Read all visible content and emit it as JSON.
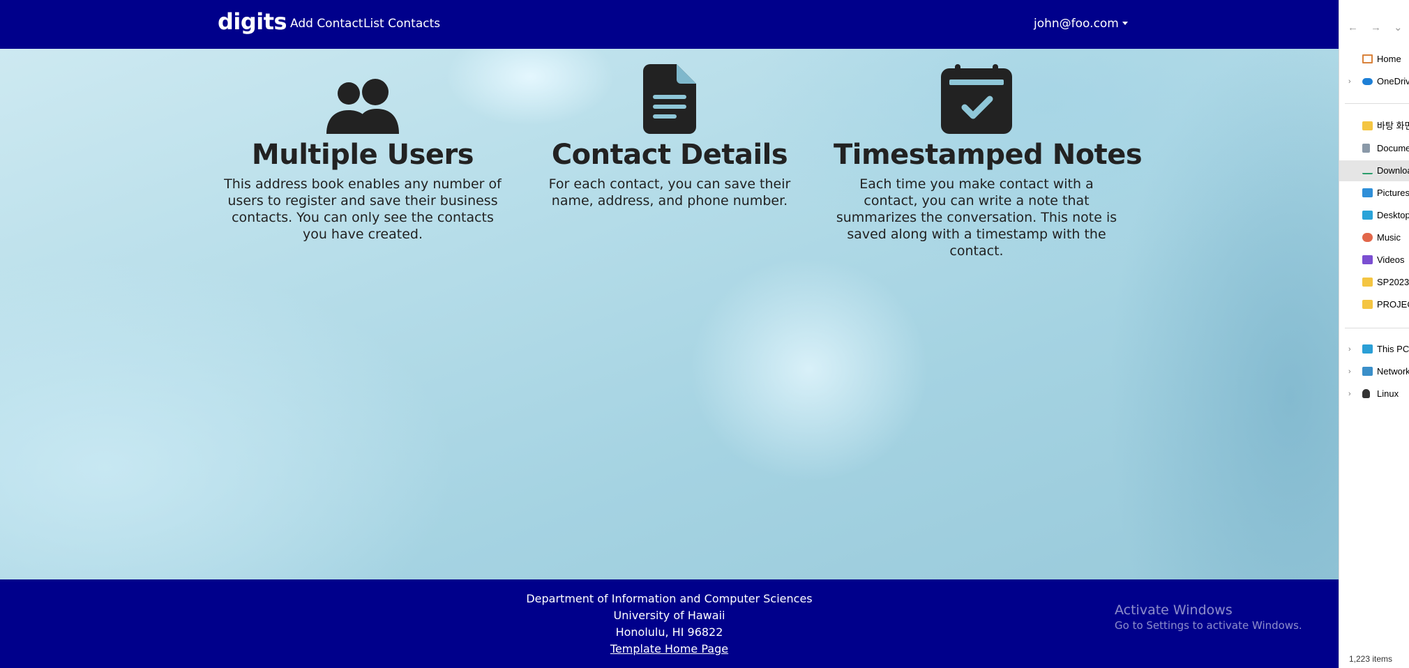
{
  "navbar": {
    "brand": "digits",
    "links": [
      "Add Contact",
      "List Contacts"
    ],
    "user": "john@foo.com"
  },
  "features": [
    {
      "icon": "users-icon",
      "title": "Multiple Users",
      "text": "This address book enables any number of users to register and save their business contacts. You can only see the contacts you have created."
    },
    {
      "icon": "file-icon",
      "title": "Contact Details",
      "text": "For each contact, you can save their name, address, and phone number."
    },
    {
      "icon": "calendar-check-icon",
      "title": "Timestamped Notes",
      "text": "Each time you make contact with a contact, you can write a note that summarizes the conversation. This note is saved along with a timestamp with the contact."
    }
  ],
  "footer": {
    "line1": "Department of Information and Computer Sciences",
    "line2": "University of Hawaii",
    "line3": "Honolulu, HI 96822",
    "link": "Template Home Page"
  },
  "watermark": {
    "title": "Activate Windows",
    "subtitle": "Go to Settings to activate Windows."
  },
  "explorer": {
    "items": [
      "Home",
      "OneDrive",
      "바탕 화면",
      "Documents",
      "Downloads",
      "Pictures",
      "Desktop",
      "Music",
      "Videos",
      "SP2023",
      "PROJECT",
      "This PC",
      "Network",
      "Linux"
    ],
    "status": "1,223 items"
  },
  "colors": {
    "navbar": "#00008b",
    "footer": "#00008b",
    "text": "#222222"
  }
}
